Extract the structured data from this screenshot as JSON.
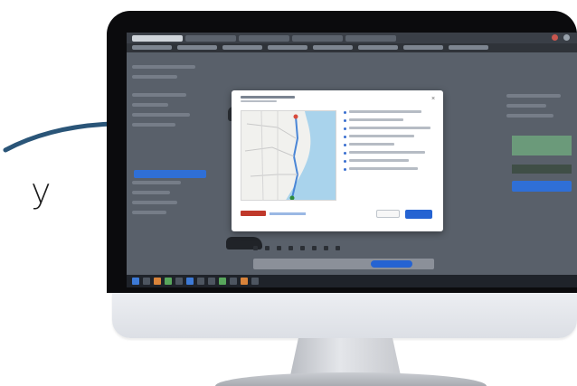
{
  "annotation": {
    "letter": "y",
    "arrow_color": "#2a5578"
  },
  "monitor": {
    "bezel_color": "#0b0b0d",
    "chin_color": "#e6e8ec"
  },
  "screen": {
    "modal": {
      "accent": "#2563d2",
      "brand_color": "#c0392b"
    },
    "page": {
      "left_button_color": "#2f6fd6",
      "right_panel_color": "#6b9a7a"
    },
    "taskbar_color": "#1f232a"
  },
  "icons": [
    "close-icon",
    "map-pin-icon",
    "car-icon"
  ]
}
